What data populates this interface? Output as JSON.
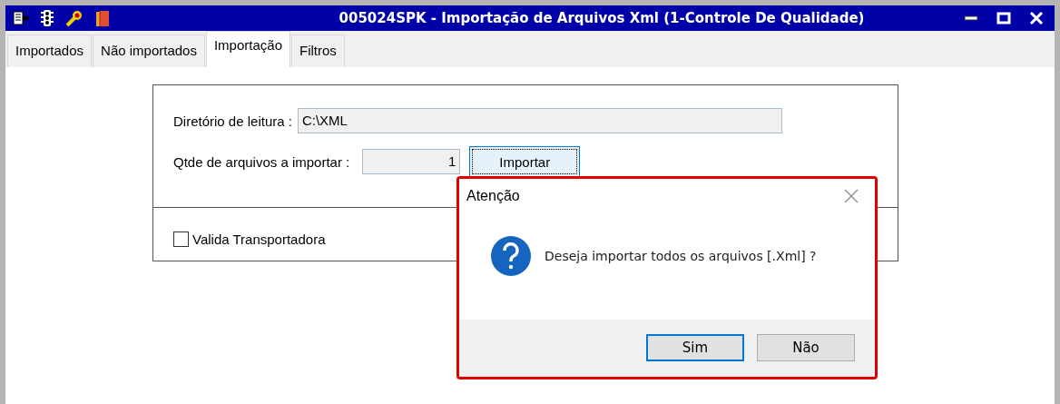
{
  "window": {
    "title": "005024SPK - Importação de Arquivos Xml (1-Controle De Qualidade)"
  },
  "tabs": [
    {
      "label": "Importados",
      "selected": false
    },
    {
      "label": "Não importados",
      "selected": false
    },
    {
      "label": "Importação",
      "selected": true
    },
    {
      "label": "Filtros",
      "selected": false
    }
  ],
  "form": {
    "directory": {
      "label": "Diretório de leitura :",
      "value": "C:\\XML"
    },
    "count": {
      "label": "Qtde de arquivos a importar :",
      "value": "1"
    },
    "import_button": {
      "label": "Importar",
      "focused": true
    },
    "validate_carrier": {
      "label": "Valida Transportadora",
      "checked": false
    }
  },
  "dialog": {
    "title": "Atenção",
    "message": "Deseja importar todos os arquivos [.Xml] ?",
    "buttons": [
      {
        "label": "Sim",
        "default": true
      },
      {
        "label": "Não",
        "default": false
      }
    ]
  }
}
